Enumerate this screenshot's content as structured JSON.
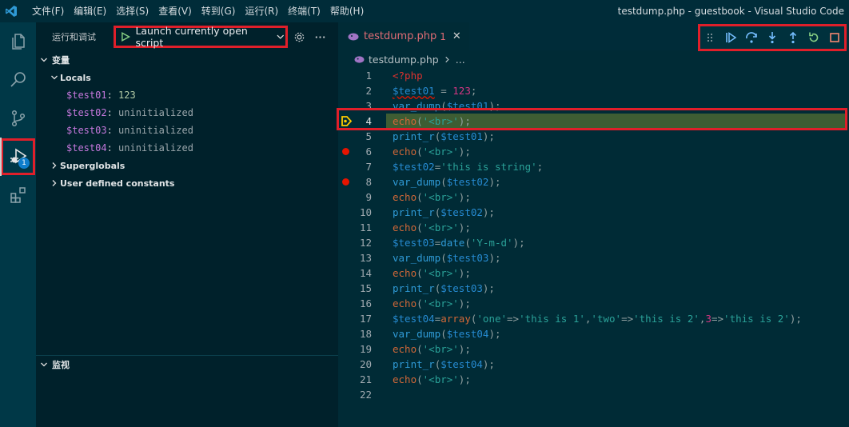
{
  "titlebar": {
    "menus": [
      "文件(F)",
      "编辑(E)",
      "选择(S)",
      "查看(V)",
      "转到(G)",
      "运行(R)",
      "终端(T)",
      "帮助(H)"
    ],
    "window_title": "testdump.php - guestbook - Visual Studio Code"
  },
  "activity": {
    "debug_badge": "1"
  },
  "sidebar": {
    "title": "运行和调试",
    "launch_config": "Launch currently open script",
    "variables_header": "变量",
    "locals_label": "Locals",
    "variables": [
      {
        "name": "$test01",
        "value": "123"
      },
      {
        "name": "$test02",
        "value": "uninitialized"
      },
      {
        "name": "$test03",
        "value": "uninitialized"
      },
      {
        "name": "$test04",
        "value": "uninitialized"
      }
    ],
    "superglobals_label": "Superglobals",
    "constants_label": "User defined constants",
    "watch_header": "监视"
  },
  "editor": {
    "tab": {
      "name": "testdump.php",
      "problems": "1"
    },
    "breadcrumb": {
      "file": "testdump.php",
      "more": "..."
    },
    "current_line": 4,
    "breakpoints": [
      6,
      8
    ],
    "line_numbers": [
      "1",
      "2",
      "3",
      "4",
      "5",
      "6",
      "7",
      "8",
      "9",
      "10",
      "11",
      "12",
      "13",
      "14",
      "15",
      "16",
      "17",
      "18",
      "19",
      "20",
      "21",
      "22"
    ]
  },
  "colors": {
    "accent_red": "#e01f2a",
    "current_line_bg": "#3e5d33",
    "breakpoint": "#e51400",
    "badge": "#0e7ecb"
  }
}
